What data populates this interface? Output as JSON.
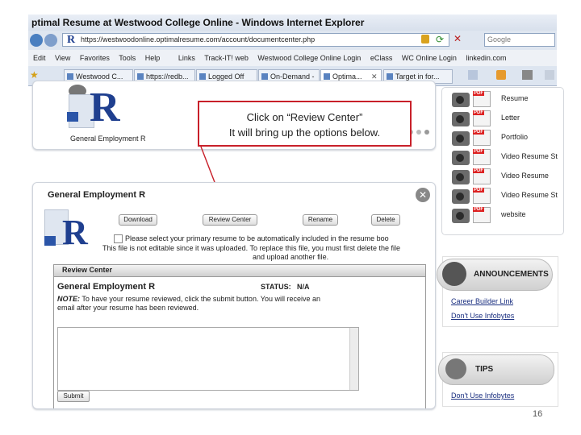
{
  "browser": {
    "title": "ptimal Resume at Westwood College Online - Windows Internet Explorer",
    "address": "https://westwoodonline.optimalresume.com/account/documentcenter.php",
    "search_placeholder": "Google",
    "menu": [
      "Edit",
      "View",
      "Favorites",
      "Tools",
      "Help"
    ],
    "links_label": "Links",
    "favorites": [
      "Track-IT! web",
      "Westwood College Online Login",
      "eClass",
      "WC Online Login",
      "linkedin.com"
    ],
    "tabs": [
      "Westwood C...",
      "https://redb...",
      "Logged Off",
      "On-Demand -",
      "Optima...",
      "Target in for..."
    ]
  },
  "top_card": {
    "doc_title": "General Employment R"
  },
  "callout": {
    "line1": "Click on “Review Center”",
    "line2": "It will bring up the options below."
  },
  "panel": {
    "title": "General Employment R",
    "buttons": {
      "download": "Download",
      "review": "Review Center",
      "rename": "Rename",
      "delete": "Delete"
    },
    "checkbox_text": "Please select your primary resume to be automatically included in the resume boo",
    "note_line1": "This file is not editable since it was uploaded. To replace this file, you must first delete the file",
    "note_line2": "and upload another file."
  },
  "review": {
    "header": "Review Center",
    "doc_name": "General Employment R",
    "status_label": "STATUS:",
    "status_value": "N/A",
    "note_prefix": "NOTE:",
    "note_text": "To have your resume reviewed, click the submit button. You will receive an",
    "note_text2": "email after your resume has been reviewed.",
    "submit": "Submit"
  },
  "right_list": [
    "Resume",
    "Letter",
    "Portfolio",
    "Video Resume St",
    "Video Resume",
    "Video Resume St",
    "website"
  ],
  "announcements": {
    "title": "ANNOUNCEMENTS",
    "links": [
      "Career Builder Link",
      "Don't Use Infobytes"
    ]
  },
  "tips": {
    "title": "TIPS",
    "links": [
      "Don't Use Infobytes"
    ]
  },
  "page_number": "16"
}
